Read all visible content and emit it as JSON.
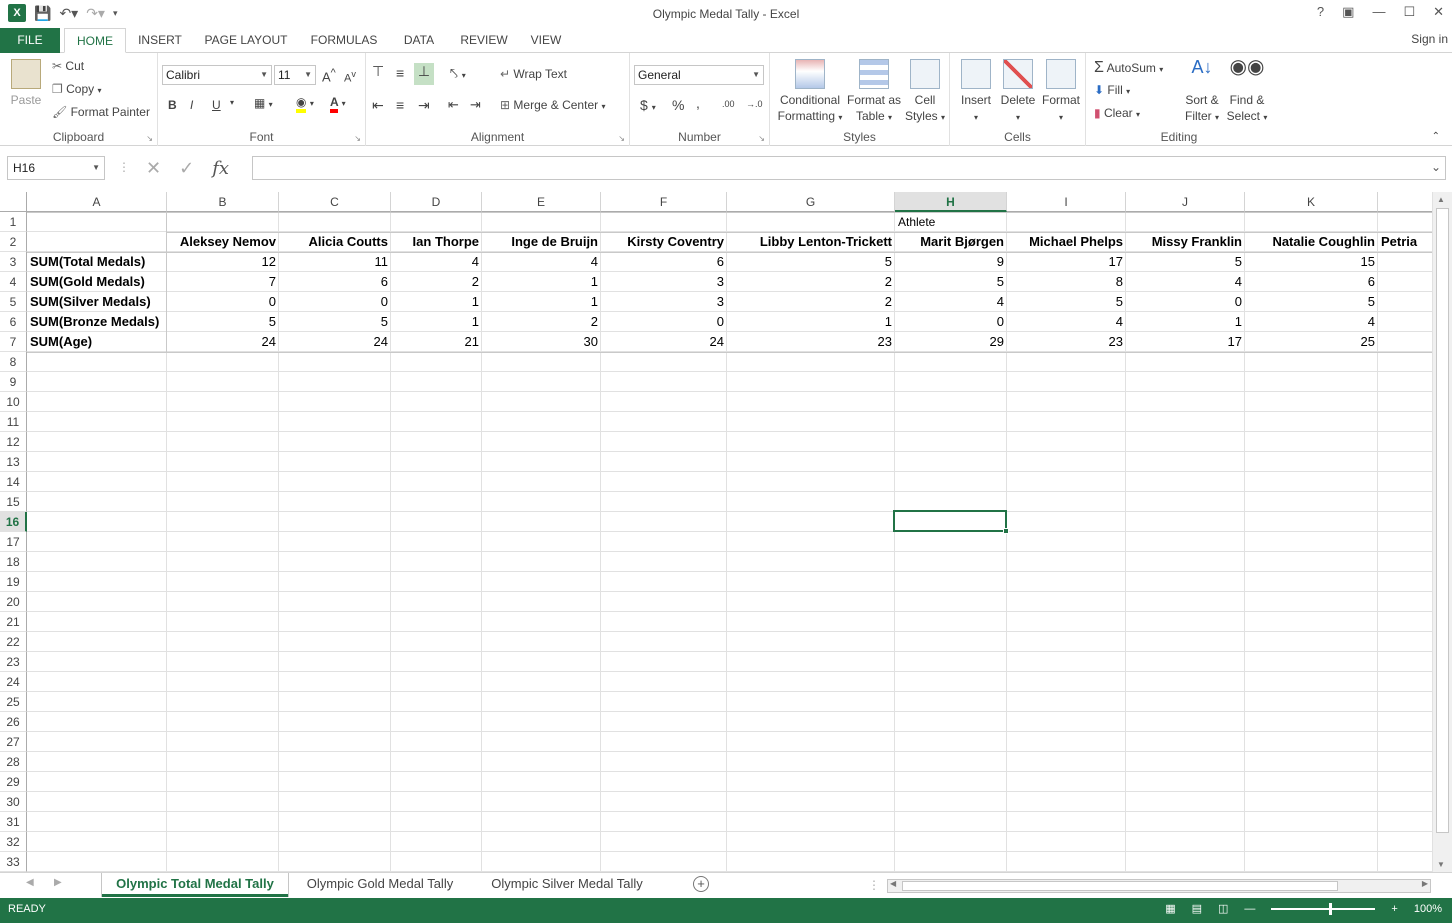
{
  "window": {
    "title": "Olympic Medal Tally - Excel",
    "help": "?",
    "sign_in": "Sign in"
  },
  "ribbon_tabs": [
    "FILE",
    "HOME",
    "INSERT",
    "PAGE LAYOUT",
    "FORMULAS",
    "DATA",
    "REVIEW",
    "VIEW"
  ],
  "ribbon": {
    "clipboard": {
      "label": "Clipboard",
      "paste": "Paste",
      "cut": "Cut",
      "copy": "Copy",
      "format_painter": "Format Painter"
    },
    "font": {
      "label": "Font",
      "name": "Calibri",
      "size": "11",
      "bold": "B",
      "italic": "I",
      "underline": "U",
      "grow": "A",
      "shrink": "A",
      "color": "A"
    },
    "alignment": {
      "label": "Alignment",
      "wrap_text": "Wrap Text",
      "merge_center": "Merge & Center"
    },
    "number": {
      "label": "Number",
      "format": "General",
      "currency": "$",
      "percent": "%",
      "comma": ",",
      "inc_dec": ".00"
    },
    "styles": {
      "label": "Styles",
      "conditional": "Conditional",
      "conditional2": "Formatting",
      "format_as": "Format as",
      "format_as2": "Table",
      "cell": "Cell",
      "cell2": "Styles"
    },
    "cells": {
      "label": "Cells",
      "insert": "Insert",
      "delete": "Delete",
      "format": "Format"
    },
    "editing": {
      "label": "Editing",
      "autosum": "AutoSum",
      "fill": "Fill",
      "clear": "Clear",
      "sort": "Sort &",
      "sort2": "Filter",
      "find": "Find &",
      "find2": "Select"
    }
  },
  "formula_bar": {
    "name_box": "H16",
    "fx": "fx",
    "formula": ""
  },
  "columns": [
    "A",
    "B",
    "C",
    "D",
    "E",
    "F",
    "G",
    "H",
    "I",
    "J",
    "K"
  ],
  "selected_column": "H",
  "rows": [
    "1",
    "2",
    "3",
    "4",
    "5",
    "6",
    "7",
    "8",
    "9",
    "10",
    "11",
    "12",
    "13",
    "14",
    "15",
    "16",
    "17",
    "18",
    "19",
    "20",
    "21",
    "22",
    "23",
    "24",
    "25",
    "26",
    "27",
    "28",
    "29",
    "30",
    "31",
    "32",
    "33"
  ],
  "selected_row": "16",
  "pivot": {
    "header": "Athlete",
    "athletes": [
      "Aleksey Nemov",
      "Alicia Coutts",
      "Ian Thorpe",
      "Inge de Bruijn",
      "Kirsty Coventry",
      "Libby Lenton-Trickett",
      "Marit Bjørgen",
      "Michael Phelps",
      "Missy Franklin",
      "Natalie Coughlin",
      "Petria"
    ],
    "measures": [
      {
        "label": "SUM(Total Medals)",
        "values": [
          "12",
          "11",
          "4",
          "4",
          "6",
          "5",
          "9",
          "17",
          "5",
          "15",
          ""
        ]
      },
      {
        "label": "SUM(Gold Medals)",
        "values": [
          "7",
          "6",
          "2",
          "1",
          "3",
          "2",
          "5",
          "8",
          "4",
          "6",
          ""
        ]
      },
      {
        "label": "SUM(Silver Medals)",
        "values": [
          "0",
          "0",
          "1",
          "1",
          "3",
          "2",
          "4",
          "5",
          "0",
          "5",
          ""
        ]
      },
      {
        "label": "SUM(Bronze Medals)",
        "values": [
          "5",
          "5",
          "1",
          "2",
          "0",
          "1",
          "0",
          "4",
          "1",
          "4",
          ""
        ]
      },
      {
        "label": "SUM(Age)",
        "values": [
          "24",
          "24",
          "21",
          "30",
          "24",
          "23",
          "29",
          "23",
          "17",
          "25",
          ""
        ]
      }
    ]
  },
  "sheets": [
    "Olympic Total Medal Tally",
    "Olympic Gold Medal Tally",
    "Olympic Silver Medal Tally"
  ],
  "active_sheet": "Olympic Total Medal Tally",
  "status": {
    "mode": "READY",
    "zoom": "100%"
  },
  "colors": {
    "accent": "#217346"
  }
}
